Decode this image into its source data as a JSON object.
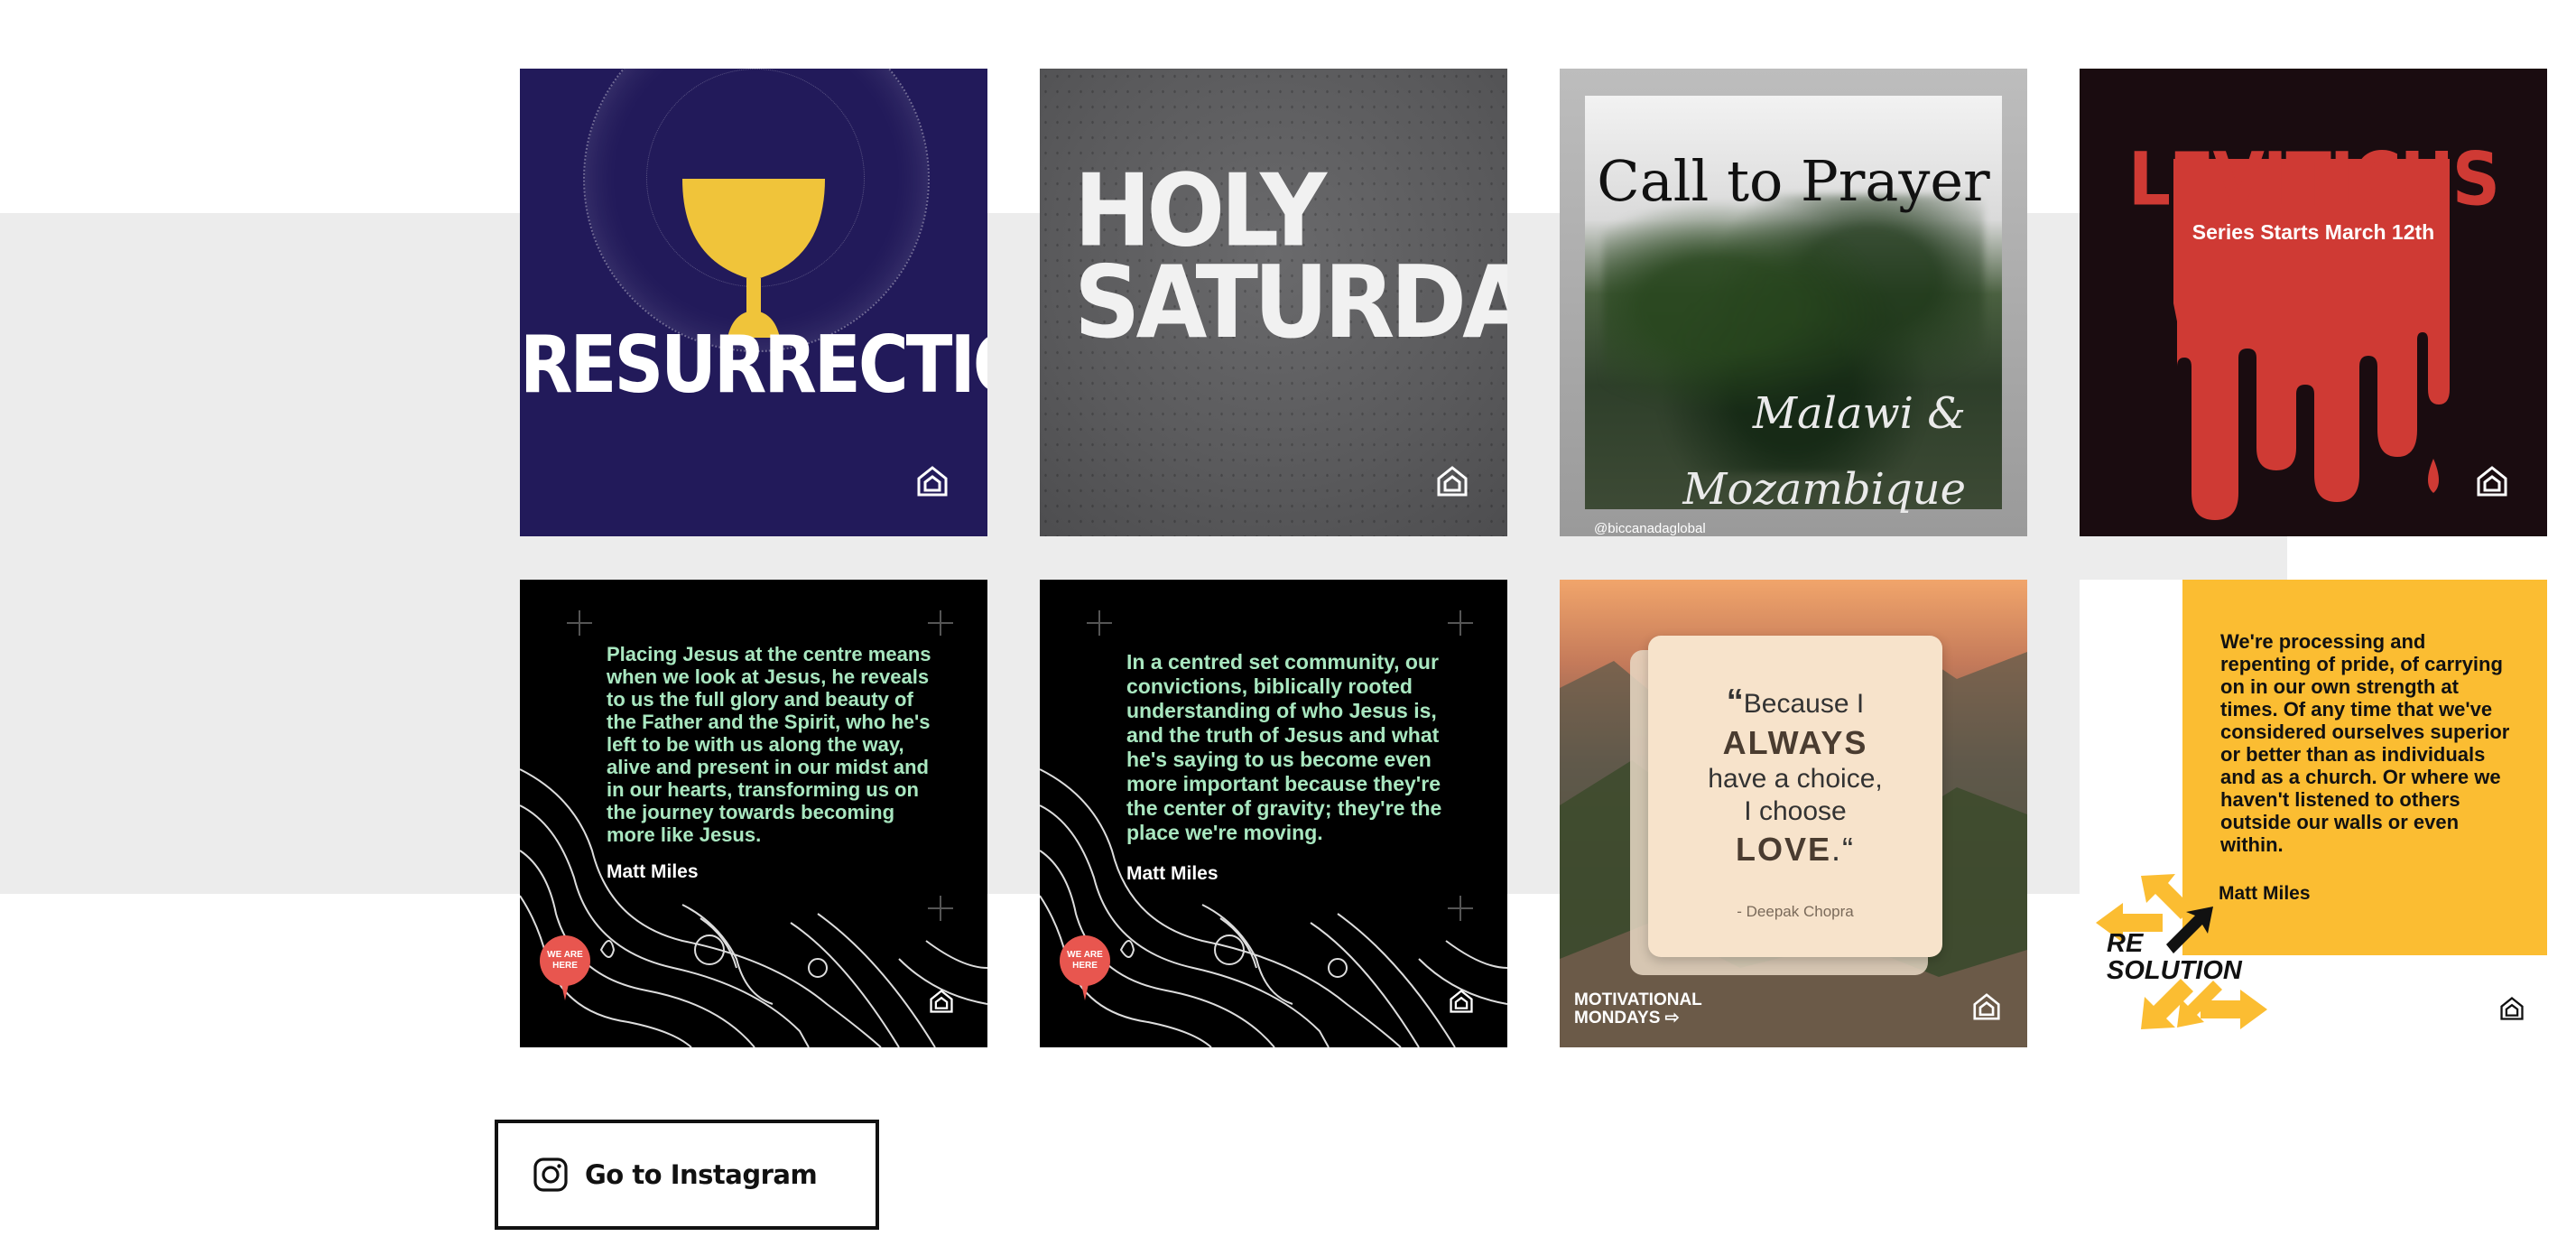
{
  "colors": {
    "band": "#ececec",
    "resurrection_bg": "#221a5a",
    "cup": "#f0c43a",
    "leviticus_red": "#cf3a34",
    "quote_green": "#a9e7c0",
    "resolution_yellow": "#fbbd32"
  },
  "posts": [
    {
      "title": "RESURRECTION",
      "icon": "church-logo-icon"
    },
    {
      "title_line1": "HOLY",
      "title_line2": "SATURDAY",
      "icon": "church-logo-icon"
    },
    {
      "title": "Call to Prayer",
      "script_line1": "Malawi &",
      "script_line2": "Mozambique",
      "handle": "@biccanadaglobal"
    },
    {
      "title": "LEVITICUS",
      "subtitle": "Series Starts March 12th",
      "icon": "church-logo-icon"
    },
    {
      "quote": "Placing Jesus at the centre means when we look at Jesus, he reveals to us the full glory and beauty of the Father and the Spirit, who he's left to be with us along the way, alive and present in our midst and in our hearts, transforming us on the journey towards becoming more like Jesus.",
      "author": "Matt Miles",
      "pin_text": "WE ARE HERE"
    },
    {
      "quote": "In a centred set community, our convictions, biblically rooted understanding of who Jesus is, and the truth of Jesus and what he's saying to us become even more important because they're the center of gravity; they're the place we're moving.",
      "author": "Matt Miles",
      "pin_text": "WE ARE HERE"
    },
    {
      "open_quote": "“",
      "line1": "Because I",
      "line2": "ALWAYS",
      "line3": "have a choice,",
      "line4": "I choose",
      "line5": "LOVE",
      "line5_end": ".“",
      "attribution": "- Deepak Chopra",
      "brand_line1": "MOTIVATIONAL",
      "brand_line2": "MONDAYS"
    },
    {
      "quote": "We're processing and repenting of pride, of carrying on in our own strength at times. Of any time that we've considered ourselves superior or better than as individuals and as a church. Or where we haven't listened to others outside our walls or even within.",
      "author": "Matt Miles",
      "brand_line1": "RE",
      "brand_line2": "SOLUTION"
    }
  ],
  "instagram_button": {
    "label": "Go to Instagram",
    "icon": "instagram-icon"
  }
}
